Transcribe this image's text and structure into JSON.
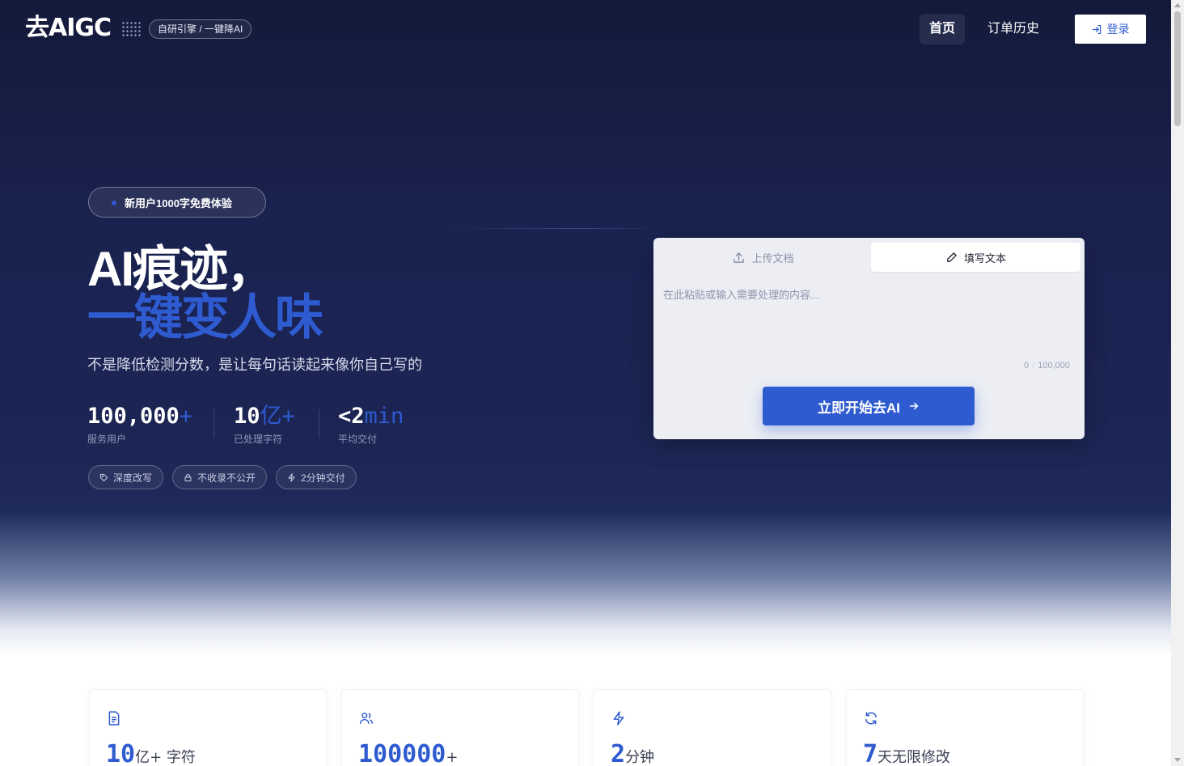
{
  "header": {
    "logo": "去AIGC",
    "badge": "自研引擎 / 一键降AI",
    "nav": {
      "home": "首页",
      "history": "订单历史",
      "login": "登录"
    }
  },
  "hero": {
    "promo_pill": "新用户1000字免费体验",
    "headline_line1": "AI痕迹，",
    "headline_line2": "一键变人味",
    "subtitle": "不是降低检测分数，是让每句话读起来像你自己写的",
    "stats": [
      {
        "value": "100,000",
        "accent": "+",
        "label": "服务用户"
      },
      {
        "value": "10",
        "accent": "亿+",
        "label": "已处理字符"
      },
      {
        "value": "<2",
        "accent": "min",
        "label": "平均交付"
      }
    ],
    "tags": [
      "深度改写",
      "不收录不公开",
      "2分钟交付"
    ]
  },
  "editor": {
    "tab_upload": "上传文档",
    "tab_write": "填写文本",
    "placeholder": "在此粘贴或输入需要处理的内容...",
    "char_count": "0",
    "char_limit": "100,000",
    "submit": "立即开始去AI"
  },
  "features": [
    {
      "icon": "document-icon",
      "value": "10",
      "unit": "亿+ 字符"
    },
    {
      "icon": "users-icon",
      "value": "100000",
      "unit": "+"
    },
    {
      "icon": "lightning-icon",
      "value": "2",
      "unit": "分钟"
    },
    {
      "icon": "refresh-icon",
      "value": "7",
      "unit": "天无限修改"
    }
  ],
  "colors": {
    "accent": "#2f5bd1",
    "hero_bg": "#1a2250",
    "card_bg": "#eceef4"
  }
}
